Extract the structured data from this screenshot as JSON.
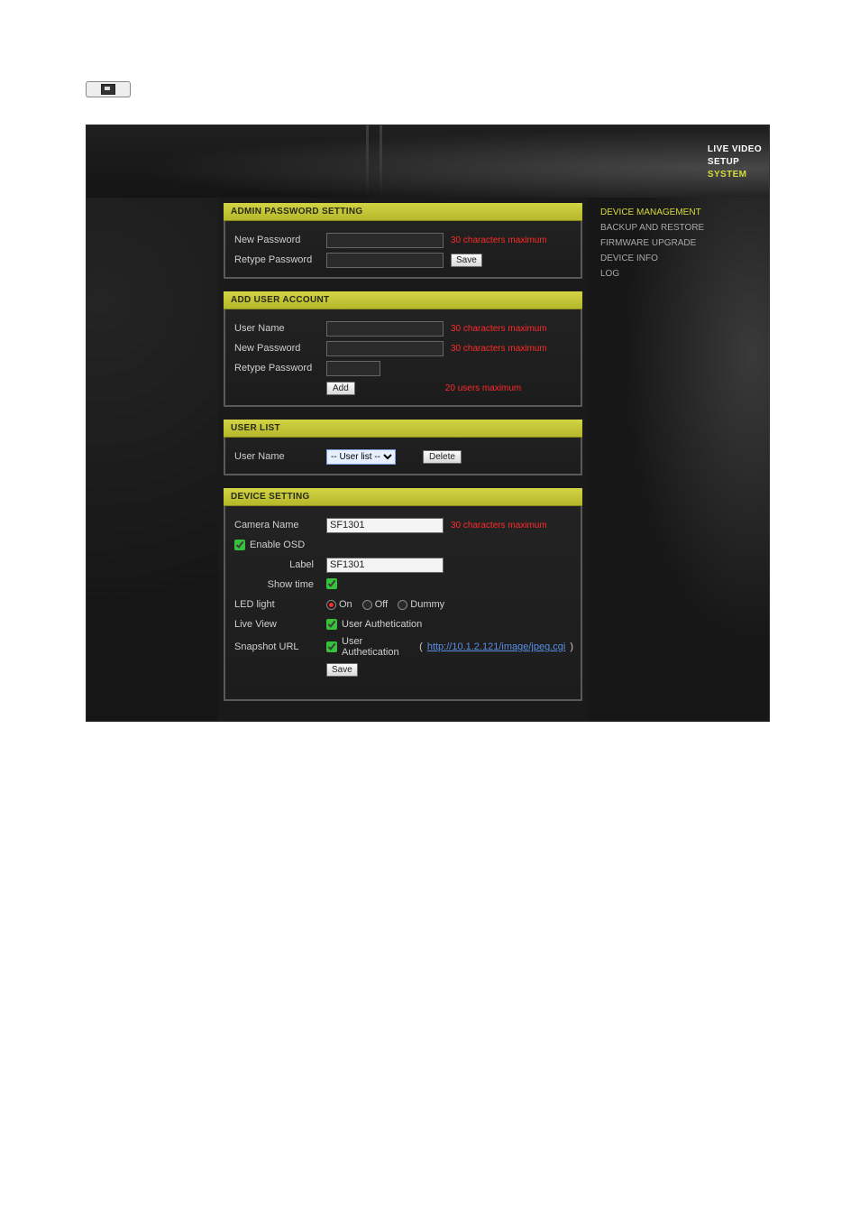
{
  "topnav": {
    "live_video": "LIVE VIDEO",
    "setup": "SETUP",
    "system": "SYSTEM"
  },
  "sidenav": {
    "device_management": "DEVICE MANAGEMENT",
    "backup_and_restore": "BACKUP AND RESTORE",
    "firmware_upgrade": "FIRMWARE UPGRADE",
    "device_info": "DEVICE INFO",
    "log": "LOG"
  },
  "panels": {
    "admin_pw": {
      "title": "ADMIN PASSWORD SETTING",
      "new_password_label": "New Password",
      "retype_password_label": "Retype Password",
      "hint": "30 characters maximum",
      "save": "Save"
    },
    "add_user": {
      "title": "ADD USER ACCOUNT",
      "user_name_label": "User Name",
      "new_password_label": "New Password",
      "retype_password_label": "Retype Password",
      "hint": "30 characters maximum",
      "hint_users": "20 users maximum",
      "add": "Add"
    },
    "user_list": {
      "title": "USER LIST",
      "user_name_label": "User Name",
      "select_default": "-- User list --",
      "delete": "Delete"
    },
    "device": {
      "title": "DEVICE SETTING",
      "camera_name_label": "Camera Name",
      "camera_name_value": "SF1301",
      "hint": "30 characters maximum",
      "enable_osd_label": "Enable OSD",
      "label_label": "Label",
      "label_value": "SF1301",
      "show_time_label": "Show time",
      "led_label": "LED light",
      "led_on": "On",
      "led_off": "Off",
      "led_dummy": "Dummy",
      "live_view_label": "Live View",
      "live_view_chk_label": "User Authetication",
      "snapshot_label": "Snapshot URL",
      "snapshot_chk_label": "User Authetication",
      "snapshot_url": "http://10.1.2.121/image/jpeg.cgi",
      "save": "Save"
    }
  }
}
